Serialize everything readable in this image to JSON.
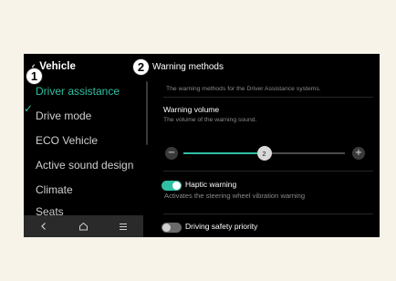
{
  "header": {
    "vehicle_title": "Vehicle",
    "warning_title": "Warning methods",
    "callout_1": "1",
    "callout_2": "2"
  },
  "sidebar": {
    "items": [
      {
        "label": "Driver assistance",
        "active": true
      },
      {
        "label": "Drive mode"
      },
      {
        "label": "ECO Vehicle"
      },
      {
        "label": "Active sound design"
      },
      {
        "label": "Climate"
      },
      {
        "label": "Seats"
      }
    ]
  },
  "navbar": {
    "back_icon": "chevron-left-icon",
    "home_icon": "home-icon",
    "menu_icon": "menu-icon"
  },
  "panel": {
    "description": "The warning methods for the Driver Assistance systems.",
    "volume": {
      "title": "Warning volume",
      "subtitle": "The volume of the warning sound.",
      "value": "2",
      "value_fraction": 0.5
    },
    "haptic": {
      "label": "Haptic warning",
      "description": "Activates the steering wheel vibration warning",
      "enabled": true
    },
    "safety": {
      "label": "Driving safety priority",
      "enabled": false
    }
  },
  "colors": {
    "accent": "#2fbfa2",
    "background": "#f7f3e8",
    "screen": "#000000"
  }
}
